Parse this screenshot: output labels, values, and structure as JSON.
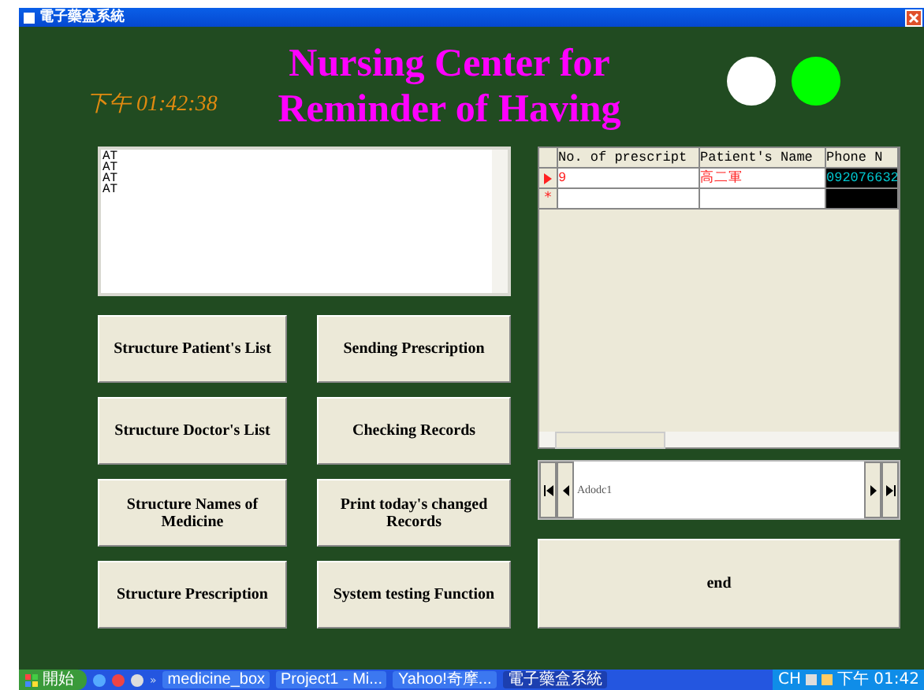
{
  "window": {
    "title": "電子藥盒系統"
  },
  "clock": "下午 01:42:38",
  "heading": [
    "Nursing Center for",
    "Reminder of Having"
  ],
  "indicators": [
    {
      "color": "#ffffff"
    },
    {
      "color": "#00ff00"
    }
  ],
  "log_box": {
    "lines": [
      "AT",
      "AT",
      "AT",
      "AT"
    ]
  },
  "buttons": [
    "Structure Patient's List",
    "Sending Prescription",
    "Structure Doctor's List",
    "Checking Records",
    "Structure Names of Medicine",
    "Print today's changed Records",
    "Structure Prescription",
    "System testing Function"
  ],
  "grid": {
    "columns": [
      "No. of prescript",
      "Patient's Name",
      "Phone N"
    ],
    "rows": [
      {
        "cells": [
          "9",
          "高二軍",
          "092076632"
        ],
        "selected": true
      }
    ],
    "new_row_marker": "*"
  },
  "navigator": {
    "caption": "Adodc1"
  },
  "end_button": "end",
  "taskbar": {
    "start": "開始",
    "quick_launch_more": "»",
    "tasks": [
      {
        "label": "medicine_box",
        "selected": false
      },
      {
        "label": "Project1 - Mi...",
        "selected": false
      },
      {
        "label": "Yahoo!奇摩...",
        "selected": false
      },
      {
        "label": "電子藥盒系統",
        "selected": true
      }
    ],
    "language": "CH",
    "time": "下午 01:42"
  }
}
